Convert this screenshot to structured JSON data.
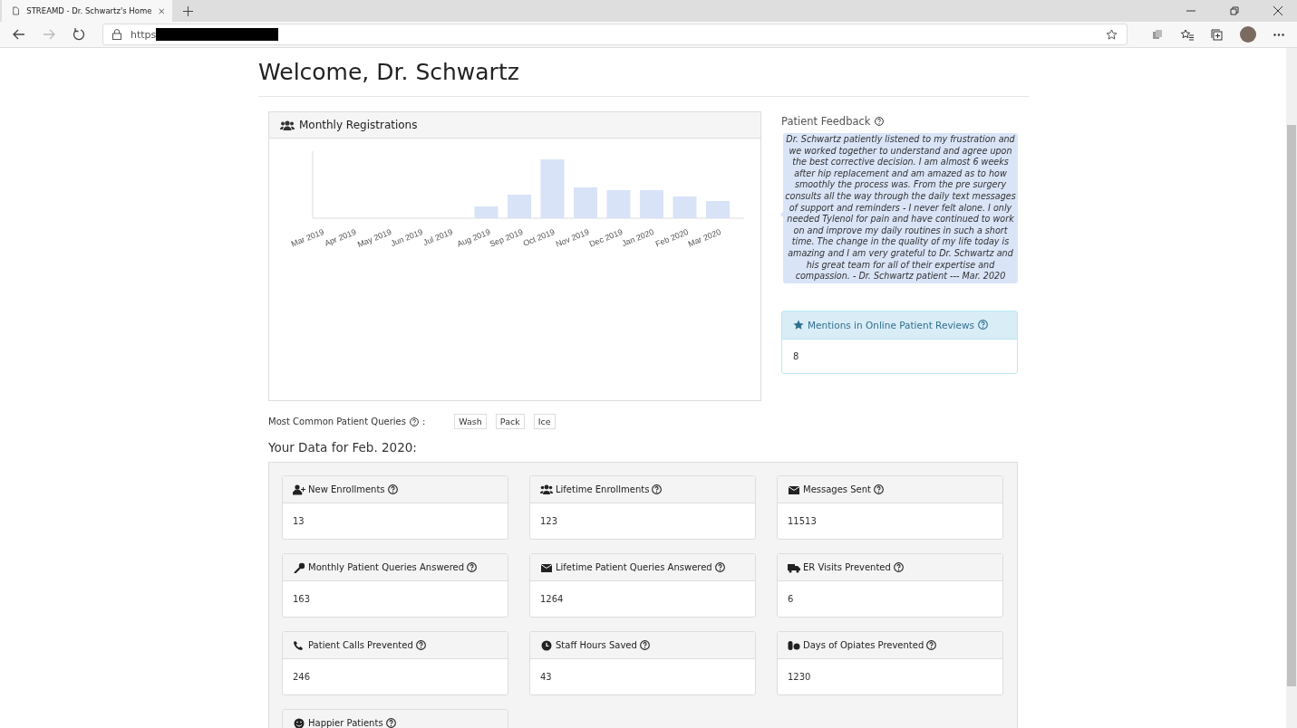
{
  "browser": {
    "tab_title": "STREAMD - Dr. Schwartz's Home",
    "url": "https"
  },
  "page_title": "Welcome, Dr. Schwartz",
  "registrations": {
    "title": "Monthly Registrations",
    "x_labels": [
      "Mar 2019",
      "Apr 2019",
      "May 2019",
      "Jun 2019",
      "Jul 2019",
      "Aug 2019",
      "Sep 2019",
      "Oct 2019",
      "Nov 2019",
      "Dec 2019",
      "Jan 2020",
      "Feb 2020",
      "Mar 2020"
    ]
  },
  "feedback": {
    "label": "Patient Feedback",
    "quote": "Dr. Schwartz patiently listened to my frustration and we worked together to understand and agree upon the best corrective decision. I am almost 6 weeks after hip replacement and am amazed as to how smoothly the process was. From the pre surgery consults all the way through the daily text messages of support and reminders - I never felt alone. I only needed Tylenol for pain and have continued to work on and improve my daily routines in such a short time. The change in the quality of my life today is amazing and I am very grateful to Dr. Schwartz and his great team for all of their expertise and compassion. - Dr. Schwartz patient --- Mar. 2020"
  },
  "mentions": {
    "title": "Mentions in Online Patient Reviews",
    "value": "8"
  },
  "queries": {
    "label": "Most Common Patient Queries",
    "colon": ":",
    "tags": [
      "Wash",
      "Pack",
      "Ice"
    ]
  },
  "data_heading": "Your Data for Feb. 2020:",
  "stats": [
    {
      "title": "New Enrollments",
      "value": "13"
    },
    {
      "title": "Lifetime Enrollments",
      "value": "123"
    },
    {
      "title": "Messages Sent",
      "value": "11513"
    },
    {
      "title": "Monthly Patient Queries Answered",
      "value": "163"
    },
    {
      "title": "Lifetime Patient Queries Answered",
      "value": "1264"
    },
    {
      "title": "ER Visits Prevented",
      "value": "6"
    },
    {
      "title": "Patient Calls Prevented",
      "value": "246"
    },
    {
      "title": "Staff Hours Saved",
      "value": "43"
    },
    {
      "title": "Days of Opiates Prevented",
      "value": "1230"
    },
    {
      "title": "Happier Patients"
    }
  ]
}
